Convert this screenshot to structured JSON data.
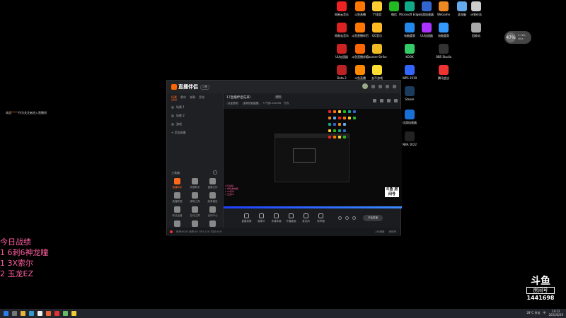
{
  "desktop": {
    "icons": [
      {
        "label": "网易云音乐",
        "color": "#e22"
      },
      {
        "label": "斗鱼直播",
        "color": "#f70"
      },
      {
        "label": "YY语音",
        "color": "#fc3"
      },
      {
        "label": "微信",
        "color": "#2b2"
      },
      {
        "label": "Microsoft Edge",
        "color": "#1a8"
      },
      {
        "label": "迅游加速器",
        "color": "#36c"
      },
      {
        "label": "WeGame",
        "color": "#e82"
      },
      {
        "label": "此电脑",
        "color": "#6ae"
      },
      {
        "label": "计划任务",
        "color": "#ccc"
      },
      {
        "label": "网易云音乐",
        "color": "#d22"
      },
      {
        "label": "斗鱼直播伴侣",
        "color": "#f70"
      },
      {
        "label": "QQ音乐",
        "color": "#fb2"
      },
      {
        "label": "电脑管家",
        "color": "#28e"
      },
      {
        "label": "UU加速器",
        "color": "#a3f"
      },
      {
        "label": "电脑管家",
        "color": "#39f"
      },
      {
        "label": "回收站",
        "color": "#aaa"
      },
      {
        "label": "UU加速器",
        "color": "#c22"
      },
      {
        "label": "斗鱼直播伴侣",
        "color": "#f60"
      },
      {
        "label": "Counter-Strike Global Off...",
        "color": "#eb2"
      },
      {
        "label": "KOOK",
        "color": "#3c6"
      },
      {
        "label": "OBS Studio",
        "color": "#333"
      },
      {
        "label": "Dota 2",
        "color": "#b22"
      },
      {
        "label": "斗鱼直播",
        "color": "#f80"
      },
      {
        "label": "金币游戏",
        "color": "#fd3"
      },
      {
        "label": "WPS 2019",
        "color": "#36f"
      },
      {
        "label": "腾讯会议",
        "color": "#e33"
      },
      {
        "label": "Steam",
        "color": "#1b3a5c"
      },
      {
        "label": "迅游加速器",
        "color": "#1a6fd6"
      },
      {
        "label": "NBA 2K22",
        "color": "#222"
      }
    ]
  },
  "welcome": {
    "prefix": "欢迎",
    "name": "*****",
    "suffix": "作为关注者进入直播间"
  },
  "stats": {
    "title": "今日战绩",
    "lines": [
      "1 6刺6神龙瞳",
      "1 3X索尔",
      "2 玉龙EZ"
    ]
  },
  "net_widget": {
    "value": "47",
    "unit": "%",
    "up": "0.1K/s",
    "down": "4K/s"
  },
  "app": {
    "logo_text": "直播伴侣",
    "version_badge": "斗鱼",
    "tab_title": "",
    "room_title": "17直播伴侣先来！",
    "room_button": "修改",
    "room_meta": [
      "认证房间",
      "游戏伴侣直播",
      "人气值1441698",
      "在线"
    ],
    "side_tabs": [
      "场景",
      "素材",
      "弹幕",
      "音效"
    ],
    "scenes": [
      "场景 1",
      "场景 2",
      "游戏",
      "+ 添加场景"
    ],
    "toolbox_title": "工具箱",
    "tools": [
      "直播助手",
      "房管助手",
      "直播日历",
      "直播数据",
      "弹幕工具",
      "超清播放",
      "粉丝运营",
      "互动工具",
      "活动中心",
      "直播录像",
      "直播公告",
      "更多"
    ],
    "controls": [
      "直播录屏",
      "摄像头",
      "多媒体源",
      "开播画面",
      "麦克风",
      "扬声器"
    ],
    "start_button": "开始直播",
    "status_left": "码率:6000  帧率:60  CPU:12%  内存:45%",
    "status_right": [
      "上传速度",
      "丢帧率"
    ],
    "preview_overlay": [
      "今日战绩",
      "1 6刺6神龙瞳",
      "1 3X索尔",
      "2 玉龙EZ"
    ],
    "watermark": "斗鱼\n房间号"
  },
  "douyu": {
    "brand": "斗鱼",
    "sub": "房间号",
    "room": "1441698"
  },
  "taskbar": {
    "items": [
      {
        "color": "#2b7de9"
      },
      {
        "color": "#777"
      },
      {
        "color": "#e8b33b"
      },
      {
        "color": "#39c"
      },
      {
        "color": "#eee"
      },
      {
        "color": "#e63"
      },
      {
        "color": "#d33"
      },
      {
        "color": "#6b6"
      },
      {
        "color": "#ec3"
      }
    ],
    "weather": "28°C 多云",
    "ime": "中",
    "time": "14:12",
    "date": "2022/6/29"
  }
}
